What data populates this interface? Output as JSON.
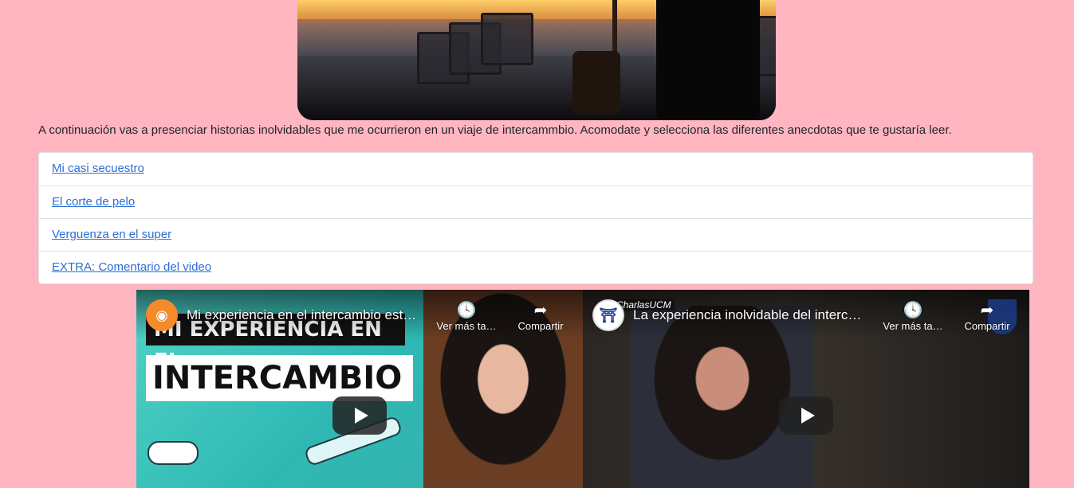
{
  "intro": "A continuación vas a presenciar historias inolvidables que me ocurrieron en un viaje de intercammbio. Acomodate y selecciona las diferentes anecdotas que te gustaría leer.",
  "links": [
    {
      "label": "Mi casi secuestro"
    },
    {
      "label": "El corte de pelo"
    },
    {
      "label": "Verguenza en el super"
    },
    {
      "label": "EXTRA: Comentario del video"
    }
  ],
  "videos": [
    {
      "title": "Mi experiencia en el intercambio est…",
      "watch_later": "Ver más ta…",
      "share": "Compartir",
      "thumb_line1": "MI EXPERIENCIA EN EL",
      "thumb_line2": "INTERCAMBIO"
    },
    {
      "title": "La experiencia inolvidable del interc…",
      "watch_later": "Ver más ta…",
      "share": "Compartir",
      "thumb_tag": "CharlasUCM"
    }
  ],
  "icons": {
    "clock": "clock-icon",
    "share": "share-icon",
    "play": "play-icon"
  }
}
